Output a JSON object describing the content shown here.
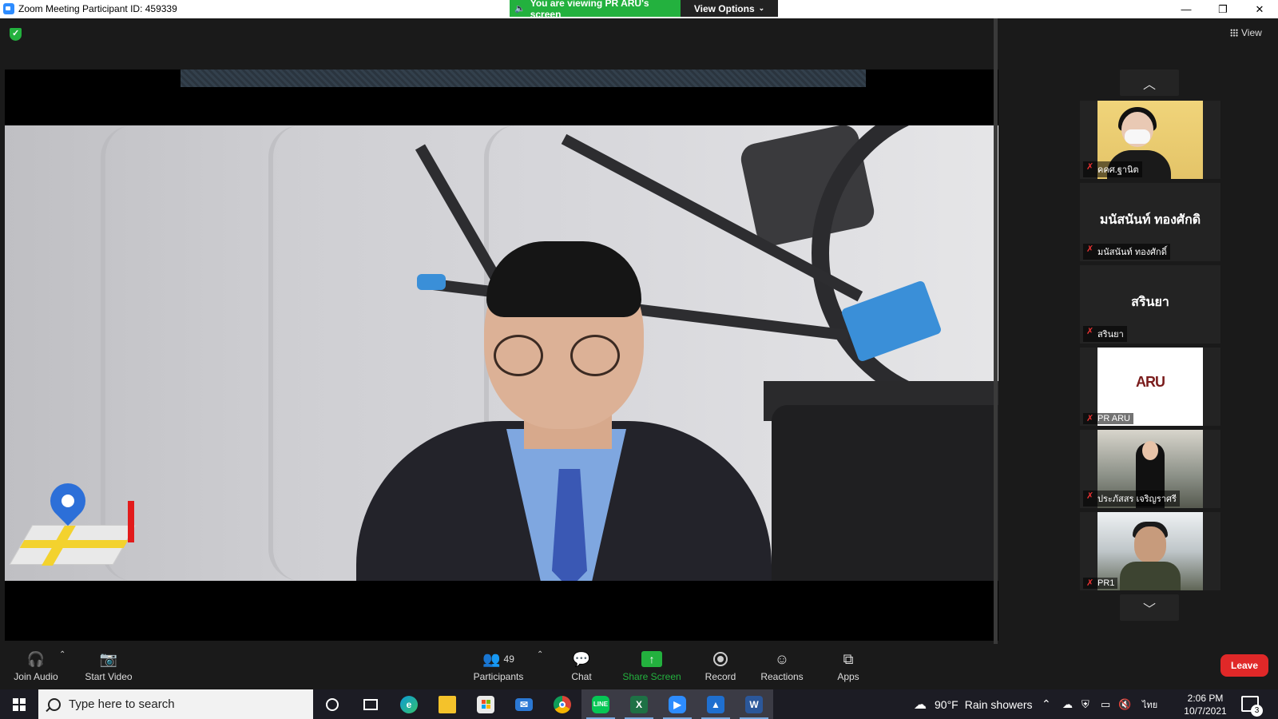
{
  "window": {
    "title": "Zoom Meeting Participant ID: 459339",
    "viewing_banner": "You are viewing PR ARU's screen",
    "view_options": "View Options",
    "view_button": "View"
  },
  "participants": [
    {
      "label": "คคศ.ฐานิต",
      "type": "video",
      "mic": "muted"
    },
    {
      "display_name": "มนัสนันท์ ทองศักดิ",
      "label": "มนัสนันท์ ทองศักดิ์",
      "type": "name",
      "mic": "muted"
    },
    {
      "display_name": "สรินยา",
      "label": "สรินยา",
      "type": "name",
      "mic": "muted"
    },
    {
      "label": "PR ARU",
      "logo_text": "ARU",
      "type": "logo",
      "mic": "muted"
    },
    {
      "label": "ประภัสสร เจริญราศรี",
      "type": "video",
      "mic": "muted"
    },
    {
      "label": "PR1",
      "type": "video",
      "mic": "muted"
    }
  ],
  "toolbar": {
    "join_audio": "Join Audio",
    "start_video": "Start Video",
    "participants": "Participants",
    "participants_count": "49",
    "chat": "Chat",
    "share_screen": "Share Screen",
    "record": "Record",
    "reactions": "Reactions",
    "apps": "Apps",
    "leave": "Leave"
  },
  "taskbar": {
    "search_placeholder": "Type here to search",
    "weather_temp": "90°F",
    "weather_desc": "Rain showers",
    "language": "ไทย",
    "time": "2:06 PM",
    "date": "10/7/2021",
    "notification_count": "3",
    "apps": [
      "cortana-icon",
      "task-view-icon",
      "edge-icon",
      "file-explorer-icon",
      "store-icon",
      "mail-icon",
      "chrome-icon",
      "line-icon",
      "excel-icon",
      "zoom-icon",
      "photos-icon",
      "word-icon"
    ]
  },
  "colors": {
    "accent_green": "#23b13e",
    "leave_red": "#e02828",
    "zoom_blue": "#2d8cff"
  }
}
